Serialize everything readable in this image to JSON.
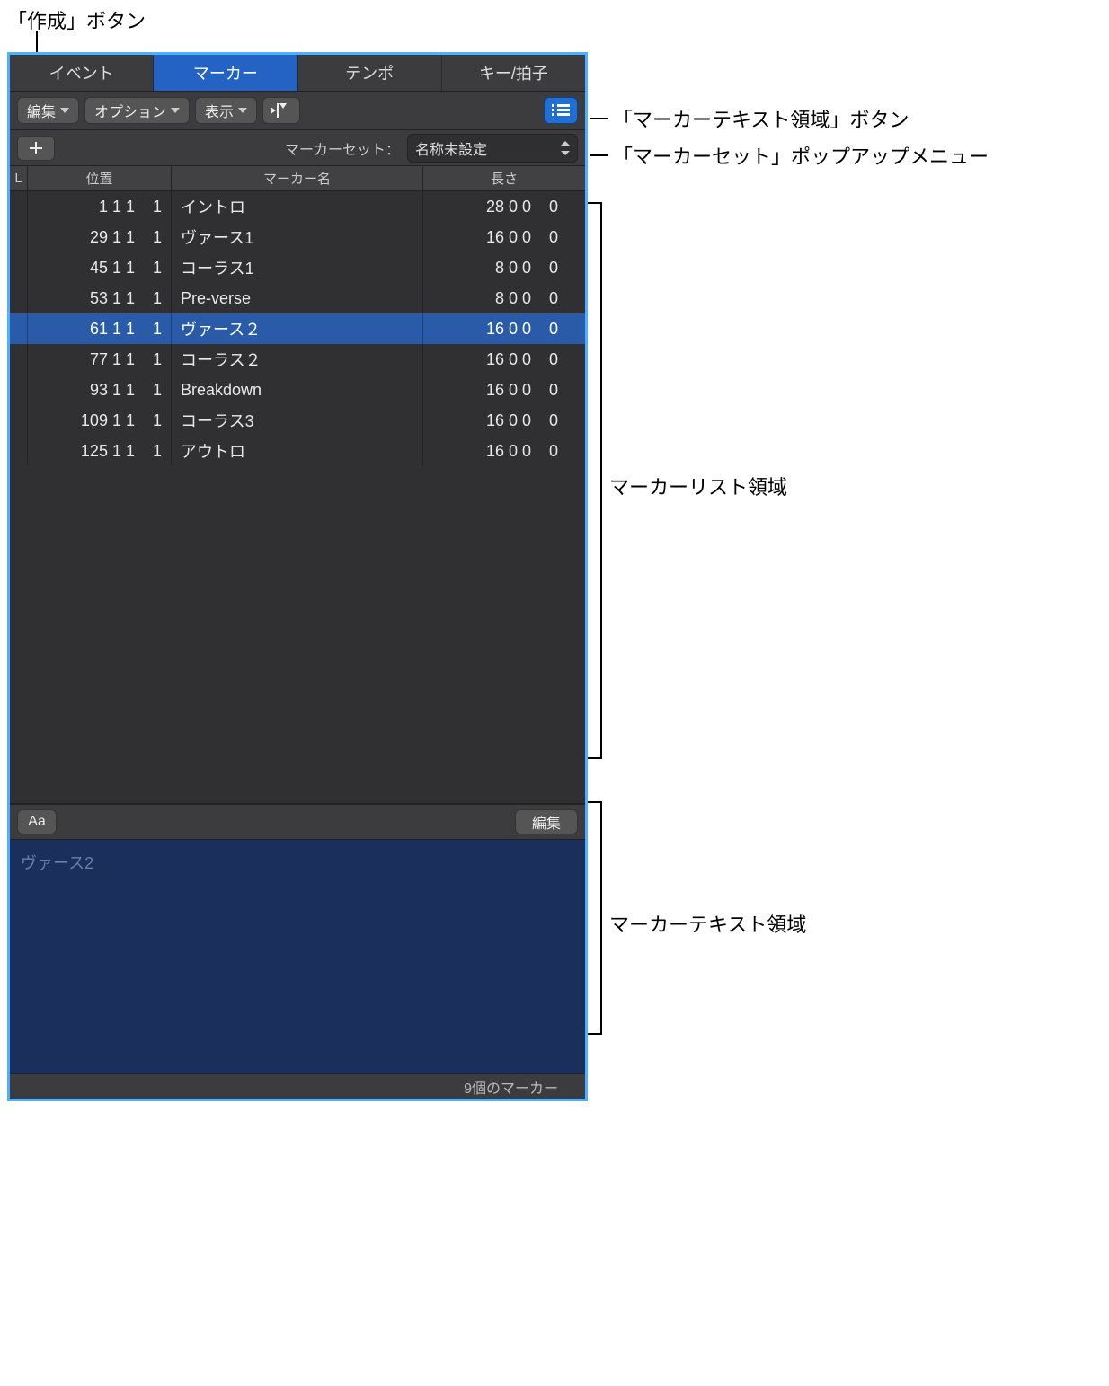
{
  "callouts": {
    "create_button": "「作成」ボタン",
    "text_area_button": "「マーカーテキスト領域」ボタン",
    "marker_set_popup": "「マーカーセット」ポップアップメニュー",
    "marker_list_area": "マーカーリスト領域",
    "marker_text_area": "マーカーテキスト領域"
  },
  "tabs": [
    {
      "label": "イベント",
      "active": false
    },
    {
      "label": "マーカー",
      "active": true
    },
    {
      "label": "テンポ",
      "active": false
    },
    {
      "label": "キー/拍子",
      "active": false
    }
  ],
  "toolbar": {
    "edit": "編集",
    "options": "オプション",
    "view": "表示"
  },
  "marker_set": {
    "label": "マーカーセット：",
    "value": "名称未設定"
  },
  "columns": {
    "l": "L",
    "position": "位置",
    "name": "マーカー名",
    "length": "長さ"
  },
  "rows": [
    {
      "pos": "1 1 1    1",
      "name": "イントロ",
      "len": "28 0 0    0",
      "selected": false
    },
    {
      "pos": "29 1 1    1",
      "name": "ヴァース1",
      "len": "16 0 0    0",
      "selected": false
    },
    {
      "pos": "45 1 1    1",
      "name": "コーラス1",
      "len": "8 0 0    0",
      "selected": false
    },
    {
      "pos": "53 1 1    1",
      "name": "Pre-verse",
      "len": "8 0 0    0",
      "selected": false
    },
    {
      "pos": "61 1 1    1",
      "name": "ヴァース２",
      "len": "16 0 0    0",
      "selected": true
    },
    {
      "pos": "77 1 1    1",
      "name": "コーラス２",
      "len": "16 0 0    0",
      "selected": false
    },
    {
      "pos": "93 1 1    1",
      "name": "Breakdown",
      "len": "16 0 0    0",
      "selected": false
    },
    {
      "pos": "109 1 1    1",
      "name": "コーラス3",
      "len": "16 0 0    0",
      "selected": false
    },
    {
      "pos": "125 1 1    1",
      "name": "アウトロ",
      "len": "16 0 0    0",
      "selected": false
    }
  ],
  "text_toolbar": {
    "aa": "Aa",
    "edit": "編集"
  },
  "text_area": {
    "content": "ヴァース2"
  },
  "status": {
    "count_text": "9個のマーカー"
  }
}
